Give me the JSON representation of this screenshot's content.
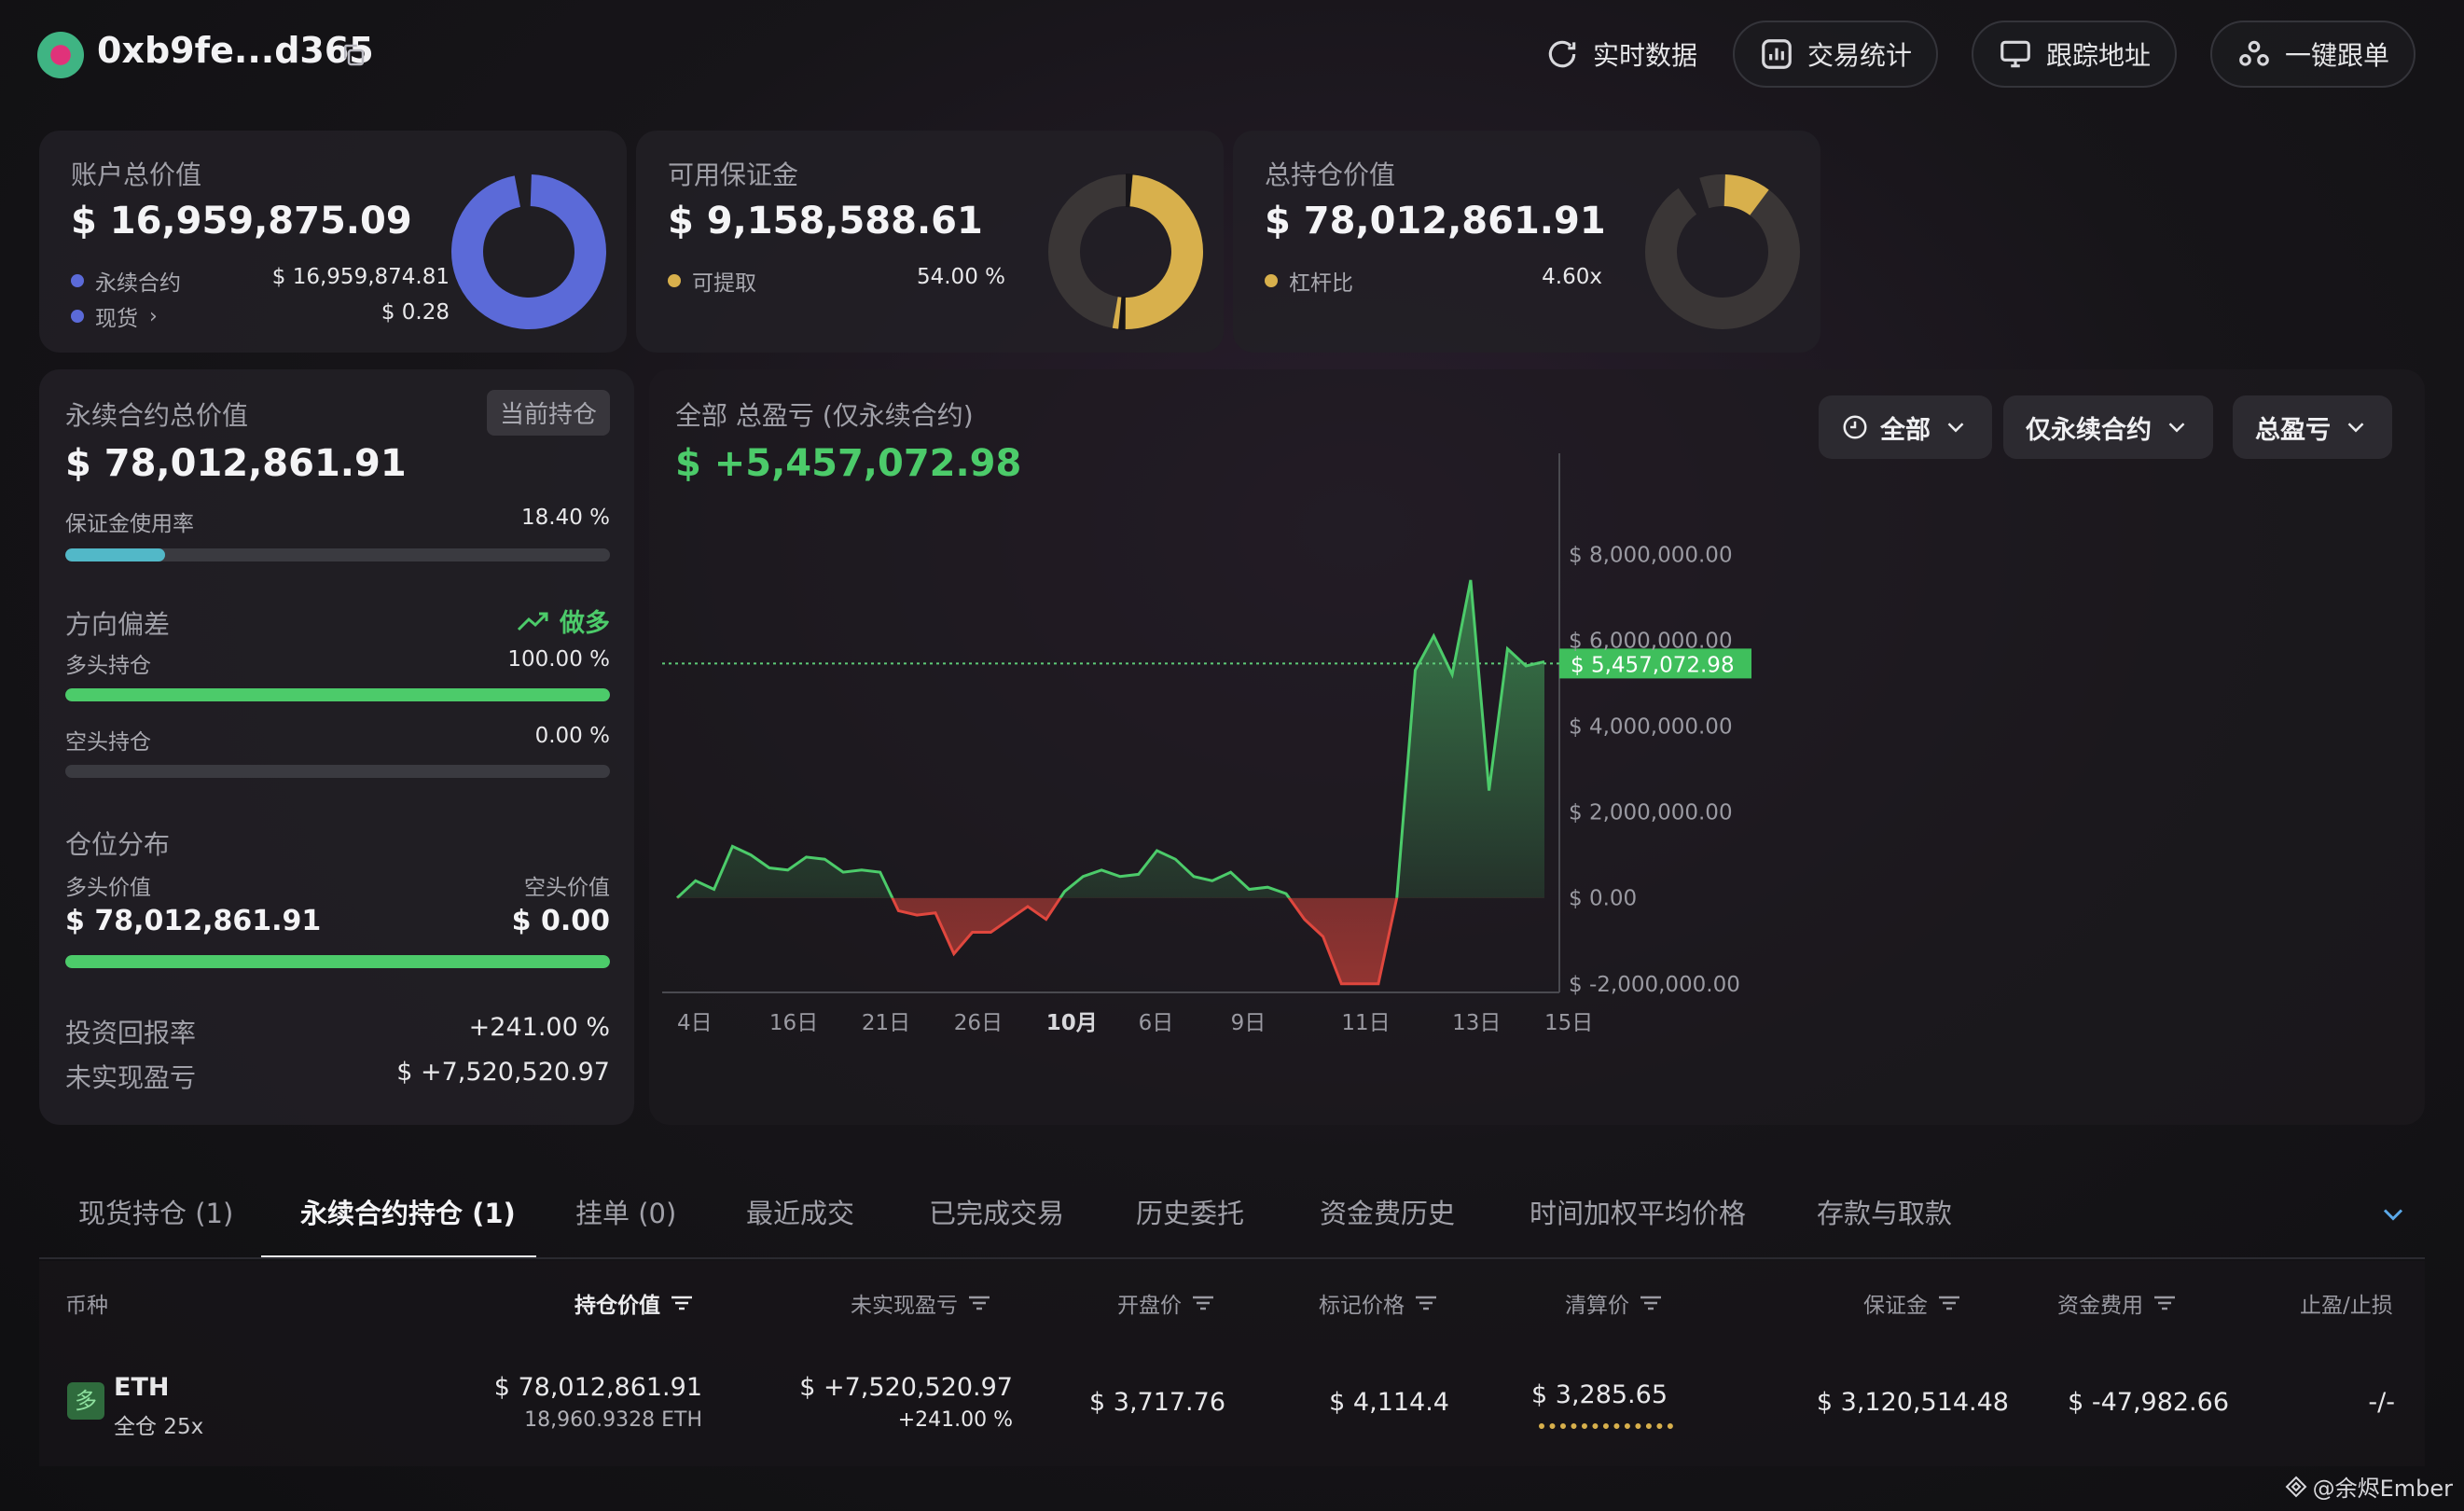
{
  "header": {
    "address": "0xb9fe...d365",
    "buttons": {
      "realtime": "实时数据",
      "trade_stats": "交易统计",
      "track": "跟踪地址",
      "copy_trade": "一键跟单"
    }
  },
  "cards": {
    "account": {
      "title": "账户总价值",
      "value": "$ 16,959,875.09",
      "rows": [
        {
          "label": "永续合约",
          "value": "$ 16,959,874.81"
        },
        {
          "label": "现货",
          "value": "$ 0.28"
        }
      ],
      "color": "#5b6ad8"
    },
    "margin": {
      "title": "可用保证金",
      "value": "$ 9,158,588.61",
      "row_label": "可提取",
      "row_value": "54.00 %",
      "color": "#d8b04c"
    },
    "position": {
      "title": "总持仓价值",
      "value": "$ 78,012,861.91",
      "row_label": "杠杆比",
      "row_value": "4.60x",
      "color": "#d8b04c"
    }
  },
  "perp": {
    "title": "永续合约总价值",
    "badge": "当前持仓",
    "value": "$ 78,012,861.91",
    "margin_usage_label": "保证金使用率",
    "margin_usage_value": "18.40 %",
    "margin_usage": 0.184,
    "bias_title": "方向偏差",
    "bias_value": "做多",
    "long_label": "多头持仓",
    "long_value": "100.00 %",
    "long_ratio": 1.0,
    "short_label": "空头持仓",
    "short_value": "0.00 %",
    "short_ratio": 0.0,
    "dist_title": "仓位分布",
    "long_val_label": "多头价值",
    "short_val_label": "空头价值",
    "long_val": "$ 78,012,861.91",
    "short_val": "$ 0.00",
    "roi_label": "投资回报率",
    "roi_value": "+241.00 %",
    "upnl_label": "未实现盈亏",
    "upnl_value": "$ +7,520,520.97"
  },
  "pnl": {
    "title": "全部 总盈亏 (仅永续合约)",
    "value": "$ +5,457,072.98",
    "filters": {
      "range": "全部",
      "scope": "仅永续合约",
      "metric": "总盈亏"
    }
  },
  "chart_data": {
    "type": "area",
    "title": "",
    "x_ticks": [
      "4日",
      "16日",
      "21日",
      "26日",
      "10月",
      "6日",
      "9日",
      "11日",
      "13日",
      "15日"
    ],
    "y_ticks": [
      "$ 8,000,000.00",
      "$ 6,000,000.00",
      "$ 4,000,000.00",
      "$ 2,000,000.00",
      "$ 0.00",
      "$ -2,000,000.00"
    ],
    "ylim": [
      -2200000,
      9700000
    ],
    "current_label": "$ 5,457,072.98",
    "current_value": 5457072.98,
    "series": [
      {
        "values": [
          0,
          400000,
          200000,
          1200000,
          1000000,
          700000,
          650000,
          950000,
          900000,
          600000,
          650000,
          600000,
          -300000,
          -400000,
          -350000,
          -1300000,
          -800000,
          -800000,
          -500000,
          -200000,
          -500000,
          150000,
          500000,
          650000,
          500000,
          550000,
          1100000,
          900000,
          500000,
          400000,
          600000,
          200000,
          250000,
          100000,
          -500000,
          -900000,
          -2000000,
          -2000000,
          -2000000,
          0,
          5300000,
          6100000,
          5200000,
          7400000,
          2500000,
          5800000,
          5400000,
          5500000
        ]
      }
    ]
  },
  "tabs": [
    "现货持仓 (1)",
    "永续合约持仓 (1)",
    "挂单 (0)",
    "最近成交",
    "已完成交易",
    "历史委托",
    "资金费历史",
    "时间加权平均价格",
    "存款与取款"
  ],
  "table": {
    "headers": [
      "币种",
      "持仓价值",
      "未实现盈亏",
      "开盘价",
      "标记价格",
      "清算价",
      "保证金",
      "资金费用",
      "止盈/止损"
    ],
    "row": {
      "side_badge": "多",
      "coin": "ETH",
      "mode": "全仓 25x",
      "value": "$ 78,012,861.91",
      "size": "18,960.9328 ETH",
      "upnl": "$ +7,520,520.97",
      "upnl_pct": "+241.00 %",
      "entry": "$ 3,717.76",
      "mark": "$ 4,114.4",
      "liq": "$ 3,285.65",
      "margin": "$ 3,120,514.48",
      "funding": "$ -47,982.66",
      "tpsl": "-/-"
    }
  },
  "watermark": "@余烬Ember"
}
